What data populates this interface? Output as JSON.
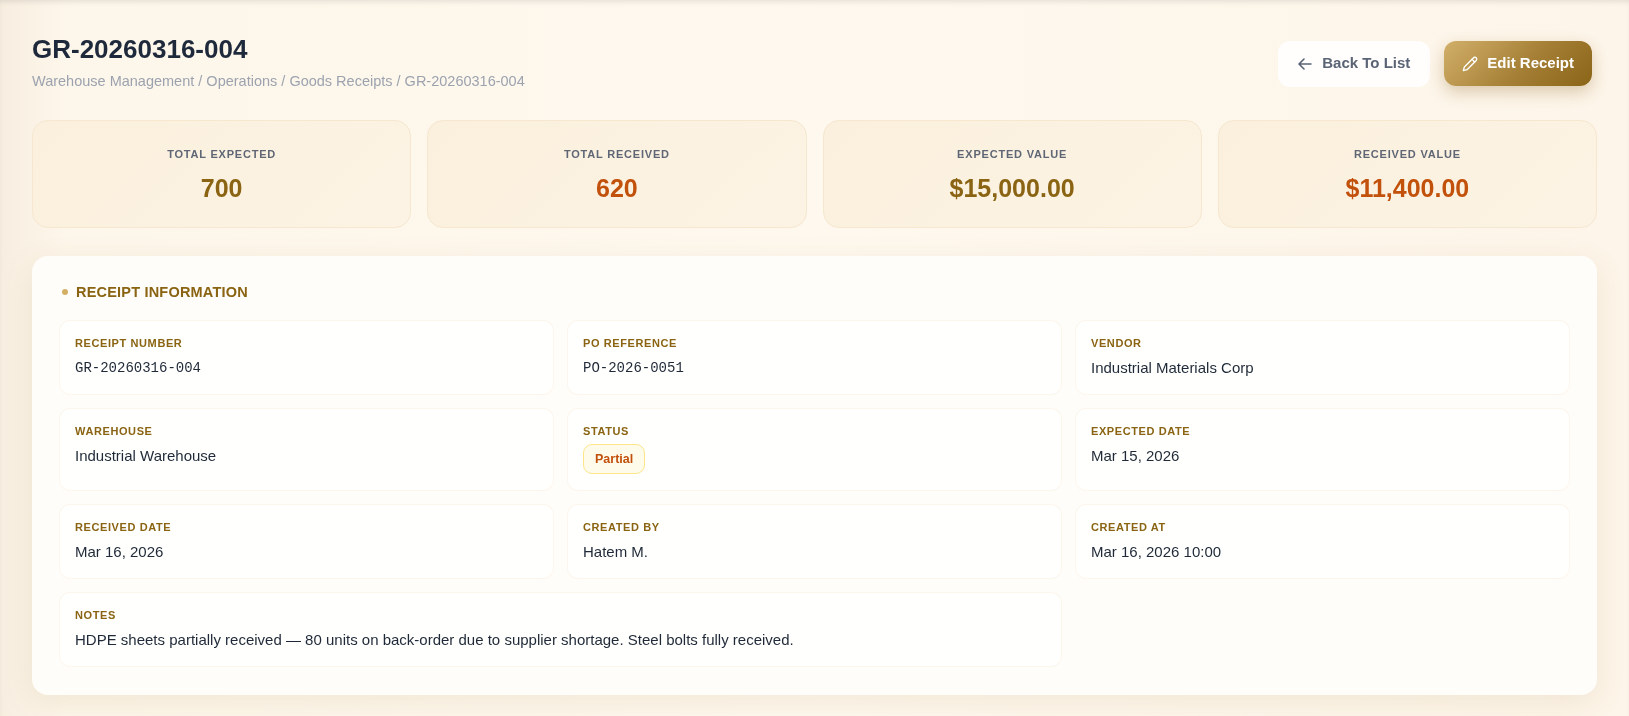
{
  "header": {
    "title": "GR-20260316-004",
    "breadcrumb": "Warehouse Management / Operations / Goods Receipts / GR-20260316-004"
  },
  "actions": [
    {
      "label": "Back To List",
      "kind": "secondary"
    },
    {
      "label": "Edit Receipt",
      "kind": "primary"
    }
  ],
  "stats": [
    {
      "label": "TOTAL EXPECTED",
      "value": "700",
      "color": "#8a6412"
    },
    {
      "label": "TOTAL RECEIVED",
      "value": "620",
      "color": "#c2510c"
    },
    {
      "label": "EXPECTED VALUE",
      "value": "$15,000.00",
      "color": "#8a6412"
    },
    {
      "label": "RECEIVED VALUE",
      "value": "$11,400.00",
      "color": "#c2510c"
    }
  ],
  "receipt_information": {
    "title": "RECEIPT INFORMATION",
    "fields": [
      {
        "label": "RECEIPT NUMBER",
        "value": "GR-20260316-004",
        "kind": "mono"
      },
      {
        "label": "PO REFERENCE",
        "value": "PO-2026-0051",
        "kind": "mono"
      },
      {
        "label": "VENDOR",
        "value": "Industrial Materials Corp",
        "kind": "text"
      },
      {
        "label": "WAREHOUSE",
        "value": "Industrial Warehouse",
        "kind": "text"
      },
      {
        "label": "STATUS",
        "value": "Partial",
        "kind": "badge"
      },
      {
        "label": "EXPECTED DATE",
        "value": "Mar 15, 2026",
        "kind": "text"
      },
      {
        "label": "RECEIVED DATE",
        "value": "Mar 16, 2026",
        "kind": "text"
      },
      {
        "label": "CREATED BY",
        "value": "Hatem M.",
        "kind": "text"
      },
      {
        "label": "CREATED AT",
        "value": "Mar 16, 2026 10:00",
        "kind": "text"
      },
      {
        "label": "NOTES",
        "value": "HDPE sheets partially received — 80 units on back-order due to supplier shortage. Steel bolts fully received.",
        "kind": "wide"
      }
    ]
  }
}
